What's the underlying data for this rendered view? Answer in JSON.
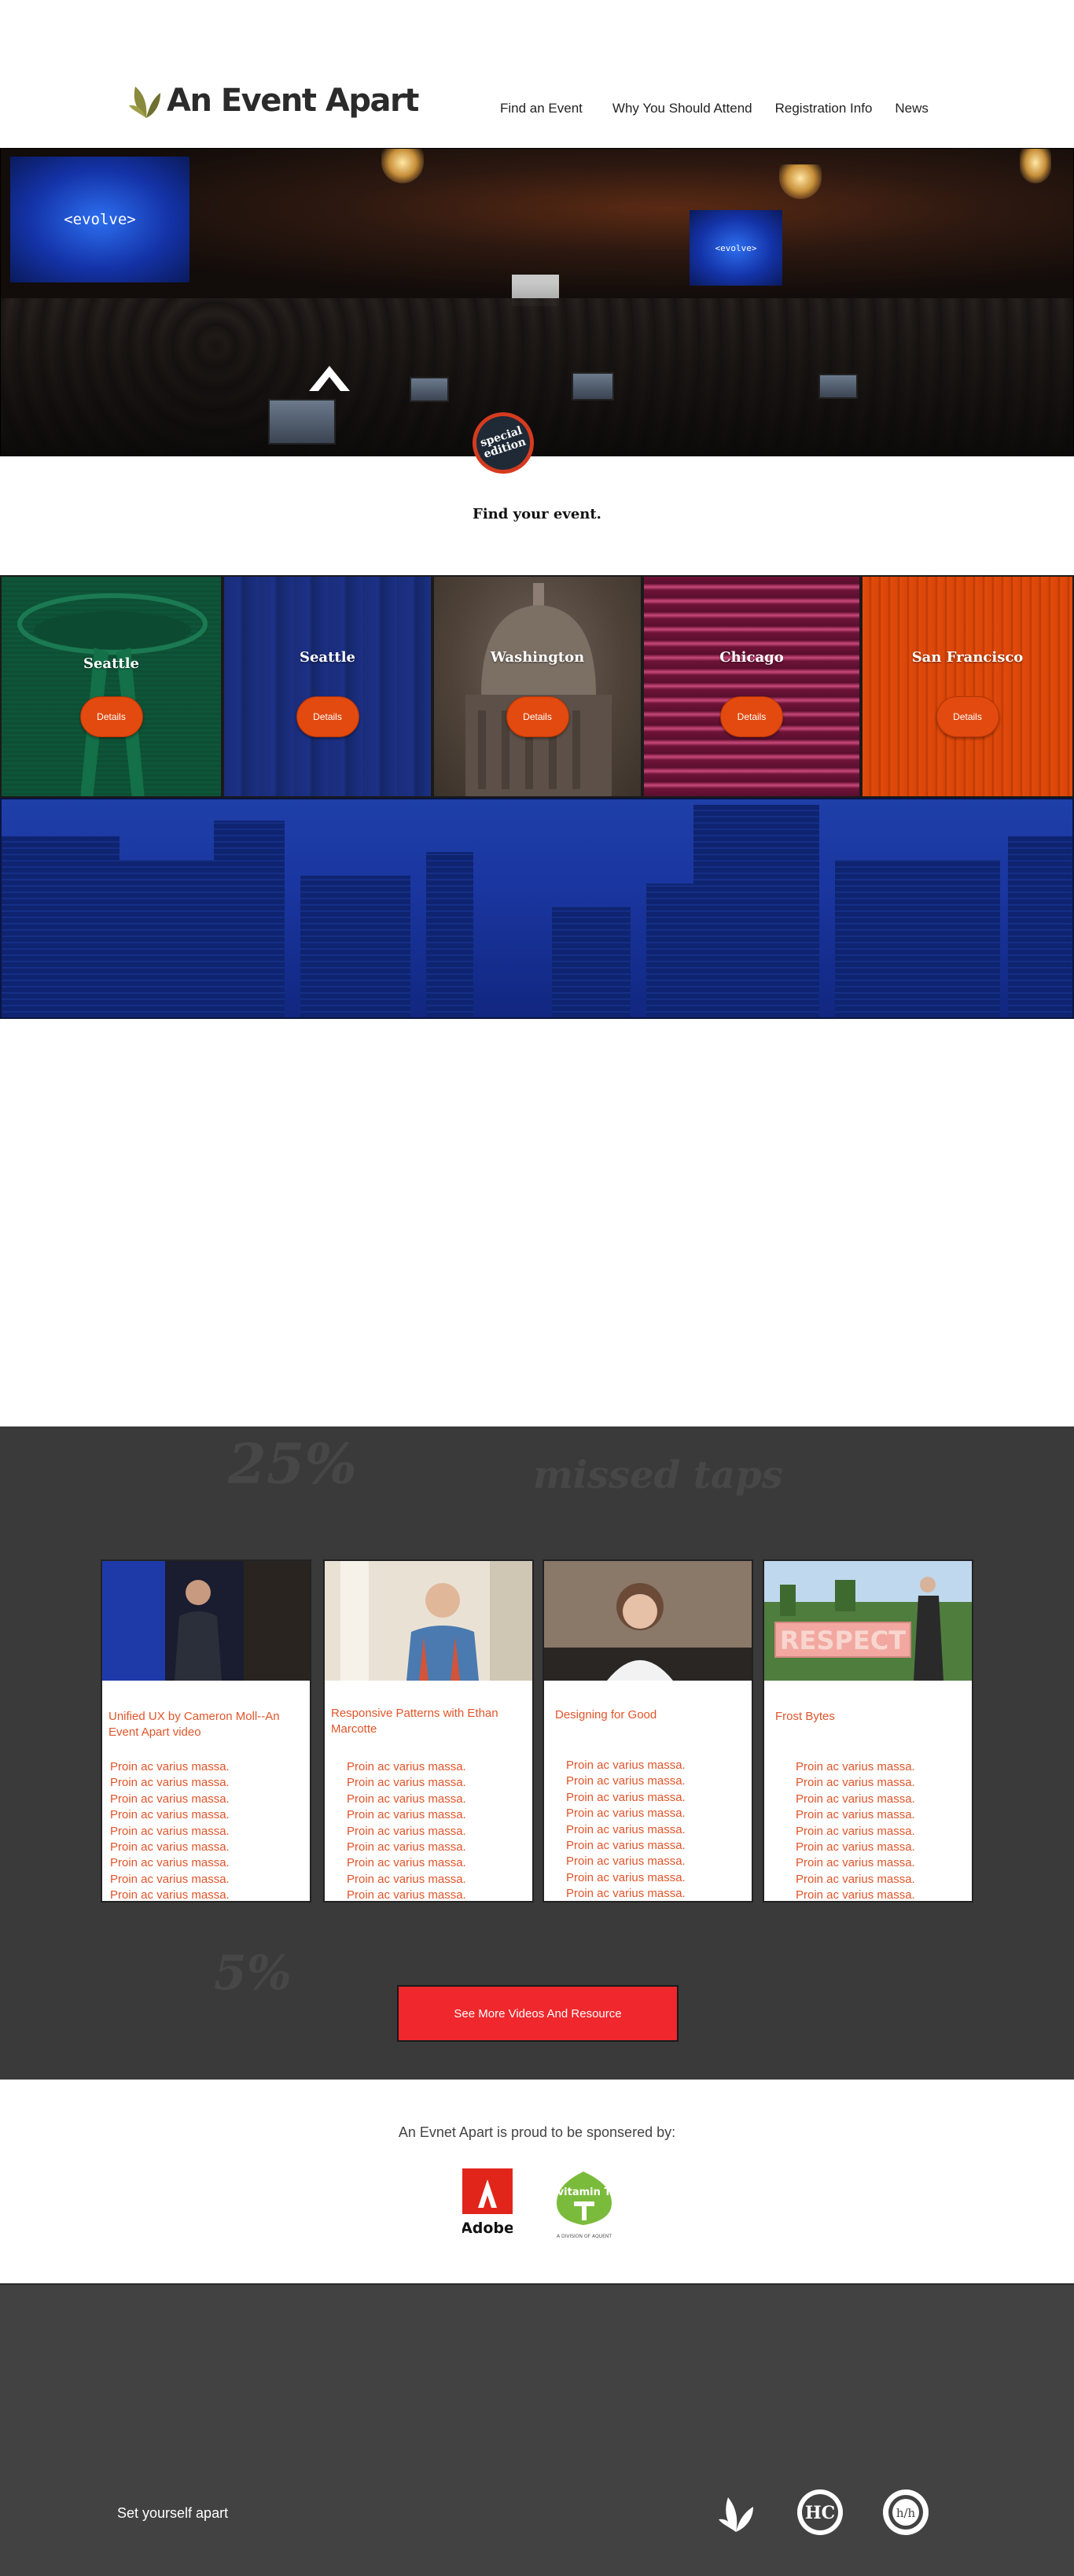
{
  "brand": {
    "name": "An Event Apart"
  },
  "nav": [
    {
      "label": "Find an Event"
    },
    {
      "label": "Why You Should Attend"
    },
    {
      "label": "Registration Info"
    },
    {
      "label": "News"
    }
  ],
  "hero": {
    "screen_left_text": "<evolve>",
    "screen_right_text": "<evolve>",
    "badge_line1": "special",
    "badge_line2": "edition"
  },
  "find": {
    "title": "Find your event."
  },
  "events": [
    {
      "city": "Seattle",
      "button": "Details"
    },
    {
      "city": "Seattle",
      "button": "Details"
    },
    {
      "city": "Washington",
      "button": "Details"
    },
    {
      "city": "Chicago",
      "button": "Details"
    },
    {
      "city": "San Francisco",
      "button": "Details"
    }
  ],
  "videos": {
    "background_words": [
      "25%",
      "missed taps",
      "5%"
    ],
    "cards": [
      {
        "title": "Unified UX by Cameron Moll--An Event Apart video",
        "items": [
          "Proin ac varius massa.",
          "Proin ac varius massa.",
          "Proin ac varius massa.",
          "Proin ac varius massa.",
          "Proin ac varius massa.",
          "Proin ac varius massa.",
          "Proin ac varius massa.",
          "Proin ac varius massa.",
          "Proin ac varius massa."
        ]
      },
      {
        "title": "Responsive Patterns with Ethan Marcotte",
        "items": [
          "Proin ac varius massa.",
          "Proin ac varius massa.",
          "Proin ac varius massa.",
          "Proin ac varius massa.",
          "Proin ac varius massa.",
          "Proin ac varius massa.",
          "Proin ac varius massa.",
          "Proin ac varius massa.",
          "Proin ac varius massa."
        ]
      },
      {
        "title": "Designing for Good",
        "items": [
          "Proin ac varius massa.",
          "Proin ac varius massa.",
          "Proin ac varius massa.",
          "Proin ac varius massa.",
          "Proin ac varius massa.",
          "Proin ac varius massa.",
          "Proin ac varius massa.",
          "Proin ac varius massa.",
          "Proin ac varius massa."
        ]
      },
      {
        "title": "Frost Bytes",
        "items": [
          "Proin ac varius massa.",
          "Proin ac varius massa.",
          "Proin ac varius massa.",
          "Proin ac varius massa.",
          "Proin ac varius massa.",
          "Proin ac varius massa.",
          "Proin ac varius massa.",
          "Proin ac varius massa.",
          "Proin ac varius massa."
        ]
      }
    ],
    "card_image_text_4": "RESPECT",
    "more_button": "See More Videos And Resource"
  },
  "sponsors": {
    "title": "An Evnet Apart is proud to be sponsered by:",
    "adobe_label": "Adobe",
    "vitamint_label": "vitamin T",
    "vitamint_sub": "A DIVISION OF AQUENT"
  },
  "footer": {
    "tagline": "Set yourself apart",
    "icons": [
      "leaf-logo-icon",
      "hc-badge-icon",
      "hh-badge-icon"
    ],
    "badge_hc": "HC",
    "badge_hh": "h/h"
  },
  "colors": {
    "accent_orange": "#e24a0f",
    "card_text": "#e0552a",
    "button_red": "#f0272c",
    "dark_section": "#3a3a3a",
    "footer": "#424242"
  }
}
